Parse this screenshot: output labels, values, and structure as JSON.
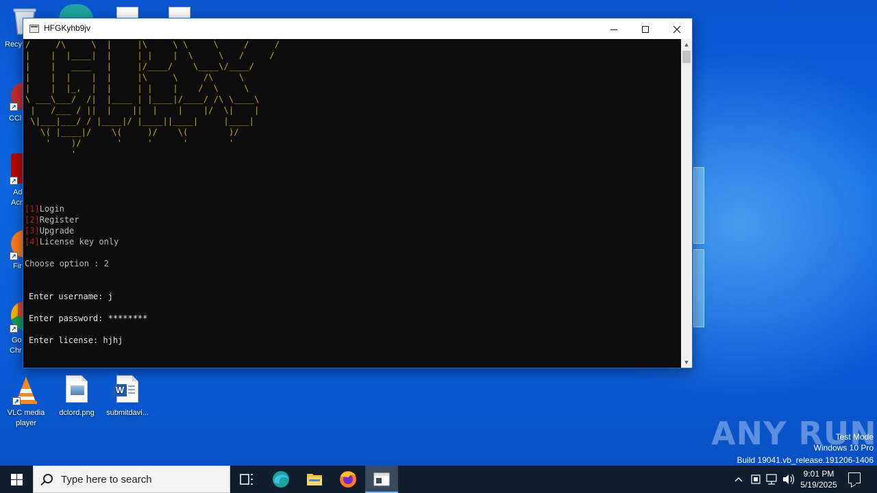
{
  "window": {
    "title": "HFGKyhb9jv",
    "ascii_art": "/     /\\     \\  |     |\\     \\ \\     \\     /     /\n|    |  |____|  |     | |    |  \\     \\   /     /\n|    |   ____   |     |/____/    \\____\\/____/\n|    |  |    |  |     |\\     \\     /\\     \\\n|    |  |_,  |  |     | |    |    /  \\     \\\n\\ ___\\___/  /|  |____ | |____|/____/ /\\ \\____\\\n |   /___ / ||  |    ||  |    |    |/  \\|    |\n \\|___|___/ / |____|/ |____||____|     |____|\n   \\( |____|/    \\(     )/    \\(        )/\n    '    )/       '     '      '        '\n         '",
    "menu": [
      {
        "num": "[1]",
        "label": "Login"
      },
      {
        "num": "[2]",
        "label": "Register"
      },
      {
        "num": "[3]",
        "label": "Upgrade"
      },
      {
        "num": "[4]",
        "label": "License key only"
      }
    ],
    "choose_prompt": "Choose option : 2",
    "username_prompt": "Enter username: j",
    "password_prompt": "Enter password: ********",
    "license_prompt": "Enter license: hjhj"
  },
  "desktop": {
    "icons": [
      {
        "label": "VLC media player"
      },
      {
        "label": "dclord.png"
      },
      {
        "label": "submitdavi..."
      }
    ],
    "partial_labels": {
      "recycle": "Recy",
      "ccleaner": "CCl",
      "acrobat_1": "Ad",
      "acrobat_2": "Acr",
      "firefox": "Fir",
      "chrome_1": "Go",
      "chrome_2": "Chr"
    }
  },
  "watermark": {
    "brand": "ANY RUN",
    "mode": "Test Mode",
    "edition": "Windows 10 Pro",
    "build": "Build 19041.vb_release.191206-1406"
  },
  "taskbar": {
    "search_placeholder": "Type here to search",
    "time": "9:01 PM",
    "date": "5/19/2025"
  },
  "colors": {
    "console_bg": "#0c0c0c",
    "ascii_yellow": "#c8b000",
    "menu_red": "#b71c1c",
    "taskbar_bg": "#101d2e"
  }
}
